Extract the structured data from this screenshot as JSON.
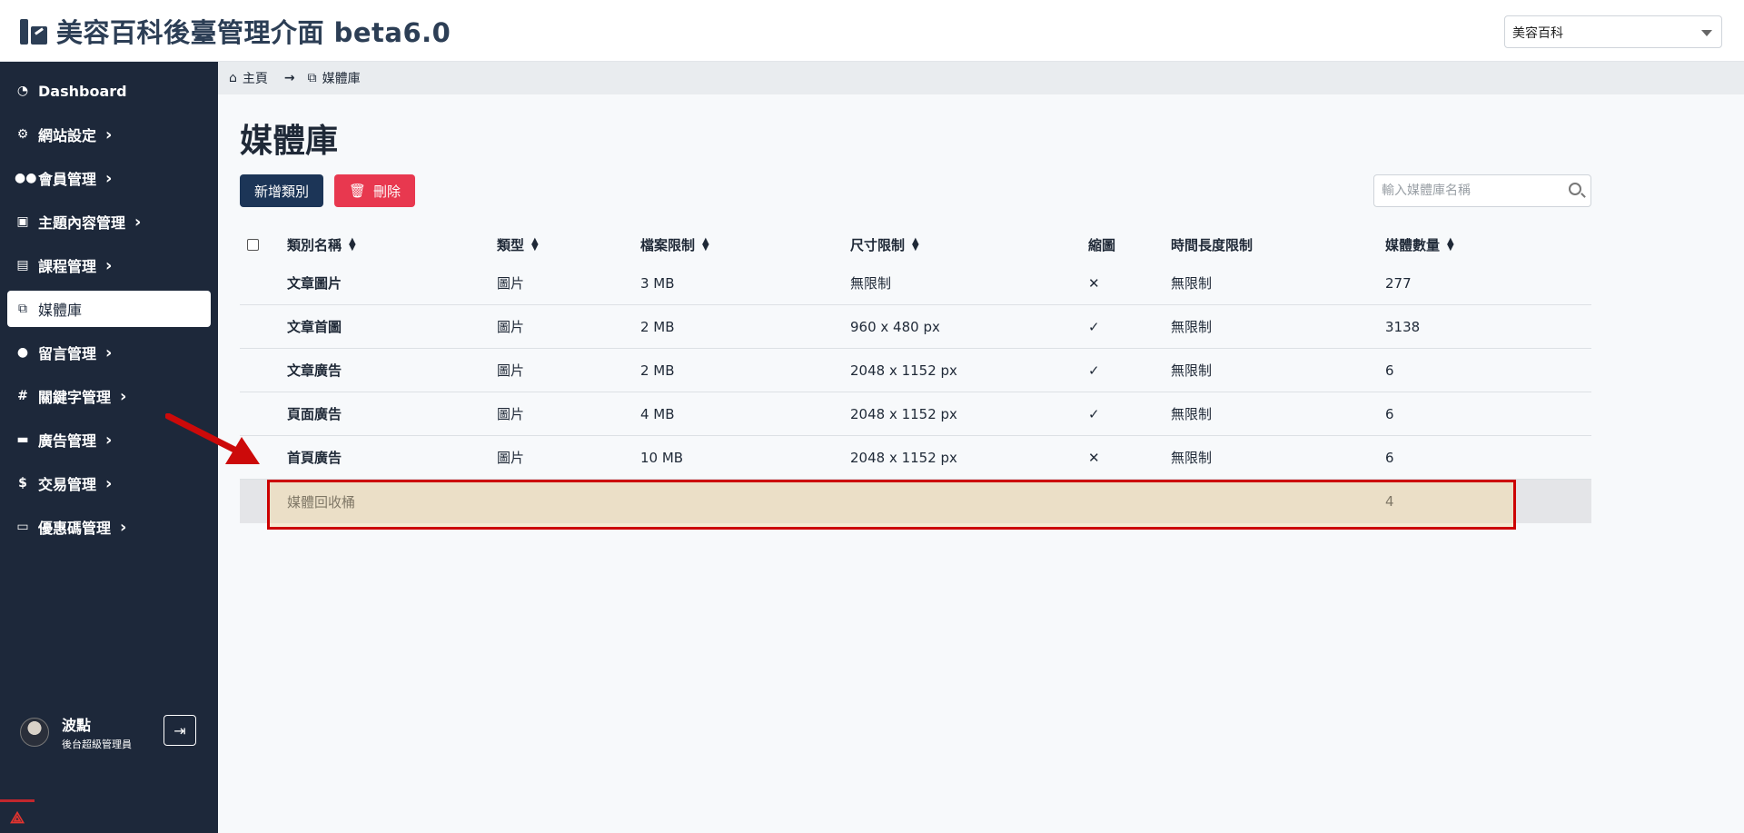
{
  "header": {
    "title": "美容百科後臺管理介面 beta6.0",
    "site_select": "美容百科"
  },
  "sidebar": {
    "items": [
      {
        "label": "Dashboard",
        "icon": "dashboard-icon"
      },
      {
        "label": "網站設定",
        "icon": "gear-icon"
      },
      {
        "label": "會員管理",
        "icon": "users-icon"
      },
      {
        "label": "主題內容管理",
        "icon": "content-icon"
      },
      {
        "label": "課程管理",
        "icon": "book-icon"
      },
      {
        "label": "媒體庫",
        "icon": "media-icon"
      },
      {
        "label": "留言管理",
        "icon": "comment-icon"
      },
      {
        "label": "關鍵字管理",
        "icon": "hash-icon"
      },
      {
        "label": "廣告管理",
        "icon": "ad-icon"
      },
      {
        "label": "交易管理",
        "icon": "money-icon"
      },
      {
        "label": "優惠碼管理",
        "icon": "ticket-icon"
      }
    ],
    "user": {
      "name": "波點",
      "role": "後台超級管理員"
    }
  },
  "breadcrumb": {
    "home": "主頁",
    "current": "媒體庫"
  },
  "page": {
    "title": "媒體庫",
    "add_label": "新增類別",
    "delete_label": "刪除",
    "search_placeholder": "輸入媒體庫名稱"
  },
  "table": {
    "headers": {
      "name": "類別名稱",
      "type": "類型",
      "file_limit": "檔案限制",
      "size_limit": "尺寸限制",
      "thumbnail": "縮圖",
      "duration_limit": "時間長度限制",
      "count": "媒體數量"
    },
    "rows": [
      {
        "name": "文章圖片",
        "type": "圖片",
        "file_limit": "3 MB",
        "size_limit": "無限制",
        "thumbnail": "✕",
        "duration_limit": "無限制",
        "count": "277"
      },
      {
        "name": "文章首圖",
        "type": "圖片",
        "file_limit": "2 MB",
        "size_limit": "960 x 480 px",
        "thumbnail": "✓",
        "duration_limit": "無限制",
        "count": "3138"
      },
      {
        "name": "文章廣告",
        "type": "圖片",
        "file_limit": "2 MB",
        "size_limit": "2048 x 1152 px",
        "thumbnail": "✓",
        "duration_limit": "無限制",
        "count": "6"
      },
      {
        "name": "頁面廣告",
        "type": "圖片",
        "file_limit": "4 MB",
        "size_limit": "2048 x 1152 px",
        "thumbnail": "✓",
        "duration_limit": "無限制",
        "count": "6"
      },
      {
        "name": "首頁廣告",
        "type": "圖片",
        "file_limit": "10 MB",
        "size_limit": "2048 x 1152 px",
        "thumbnail": "✕",
        "duration_limit": "無限制",
        "count": "6"
      }
    ],
    "trash_row": {
      "name": "媒體回收桶",
      "count": "4"
    }
  },
  "colors": {
    "sidebar_bg": "#1d283a",
    "primary_button": "#1c3557",
    "danger_button": "#e8384f",
    "annotation": "#cc0000"
  }
}
